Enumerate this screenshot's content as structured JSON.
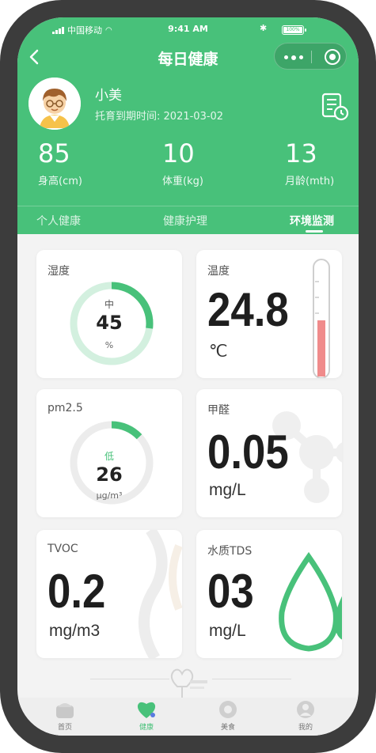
{
  "status_bar": {
    "carrier": "中国移动",
    "time": "9:41 AM",
    "battery": "100%"
  },
  "nav": {
    "title": "每日健康"
  },
  "profile": {
    "name": "小美",
    "expire_label": "托育到期时间:",
    "expire_date": "2021-03-02"
  },
  "stats": [
    {
      "value": "85",
      "label": "身高(cm)"
    },
    {
      "value": "10",
      "label": "体重(kg)"
    },
    {
      "value": "13",
      "label": "月龄(mth)"
    }
  ],
  "tabs": [
    {
      "label": "个人健康",
      "active": false
    },
    {
      "label": "健康护理",
      "active": false
    },
    {
      "label": "环境监测",
      "active": true
    }
  ],
  "cards": {
    "humidity": {
      "title": "湿度",
      "level": "中",
      "value": "45",
      "unit": "%",
      "fraction": 0.27
    },
    "temperature": {
      "title": "温度",
      "value": "24.8",
      "unit": "℃",
      "fill_fraction": 0.48
    },
    "pm25": {
      "title": "pm2.5",
      "level": "低",
      "value": "26",
      "unit": "μg/m³",
      "fraction": 0.13
    },
    "formaldehyde": {
      "title": "甲醛",
      "value": "0.05",
      "unit": "mg/L"
    },
    "tvoc": {
      "title": "TVOC",
      "value": "0.2",
      "unit": "mg/m3"
    },
    "tds": {
      "title": "水质TDS",
      "value": "03",
      "unit": "mg/L"
    }
  },
  "tabbar": [
    {
      "label": "首页",
      "active": false
    },
    {
      "label": "健康",
      "active": true
    },
    {
      "label": "美食",
      "active": false
    },
    {
      "label": "我的",
      "active": false
    }
  ],
  "colors": {
    "brand": "#48c17a",
    "ring_light": "#d3f0df",
    "ring_gray": "#ececec",
    "thermo": "#f08b8b"
  }
}
